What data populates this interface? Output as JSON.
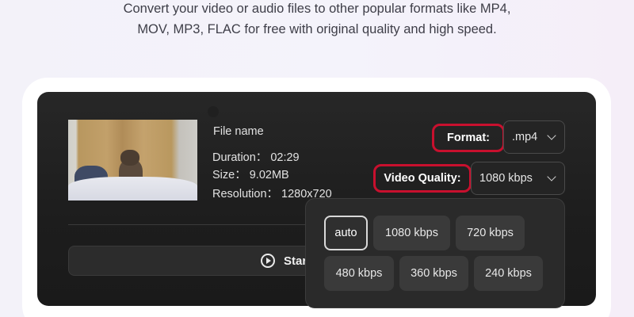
{
  "intro": {
    "line1": "Convert your video or audio files to other popular formats like MP4,",
    "line2": "MOV, MP3, FLAC for free with original quality and high speed."
  },
  "file": {
    "name_label": "File name",
    "duration": "Duration： 02:29",
    "size": "Size： 9.02MB",
    "resolution": "Resolution： 1280x720"
  },
  "format": {
    "label": "Format:",
    "value": ".mp4"
  },
  "quality": {
    "label": "Video Quality:",
    "value": "1080 kbps",
    "options": [
      "auto",
      "1080 kbps",
      "720 kbps",
      "480 kbps",
      "360 kbps",
      "240 kbps"
    ],
    "selected": "auto"
  },
  "start_button": {
    "label": "Star"
  },
  "colors": {
    "highlight_outline": "#c8102e",
    "panel_bg": "#222222",
    "option_bg": "#3a3a3a"
  }
}
